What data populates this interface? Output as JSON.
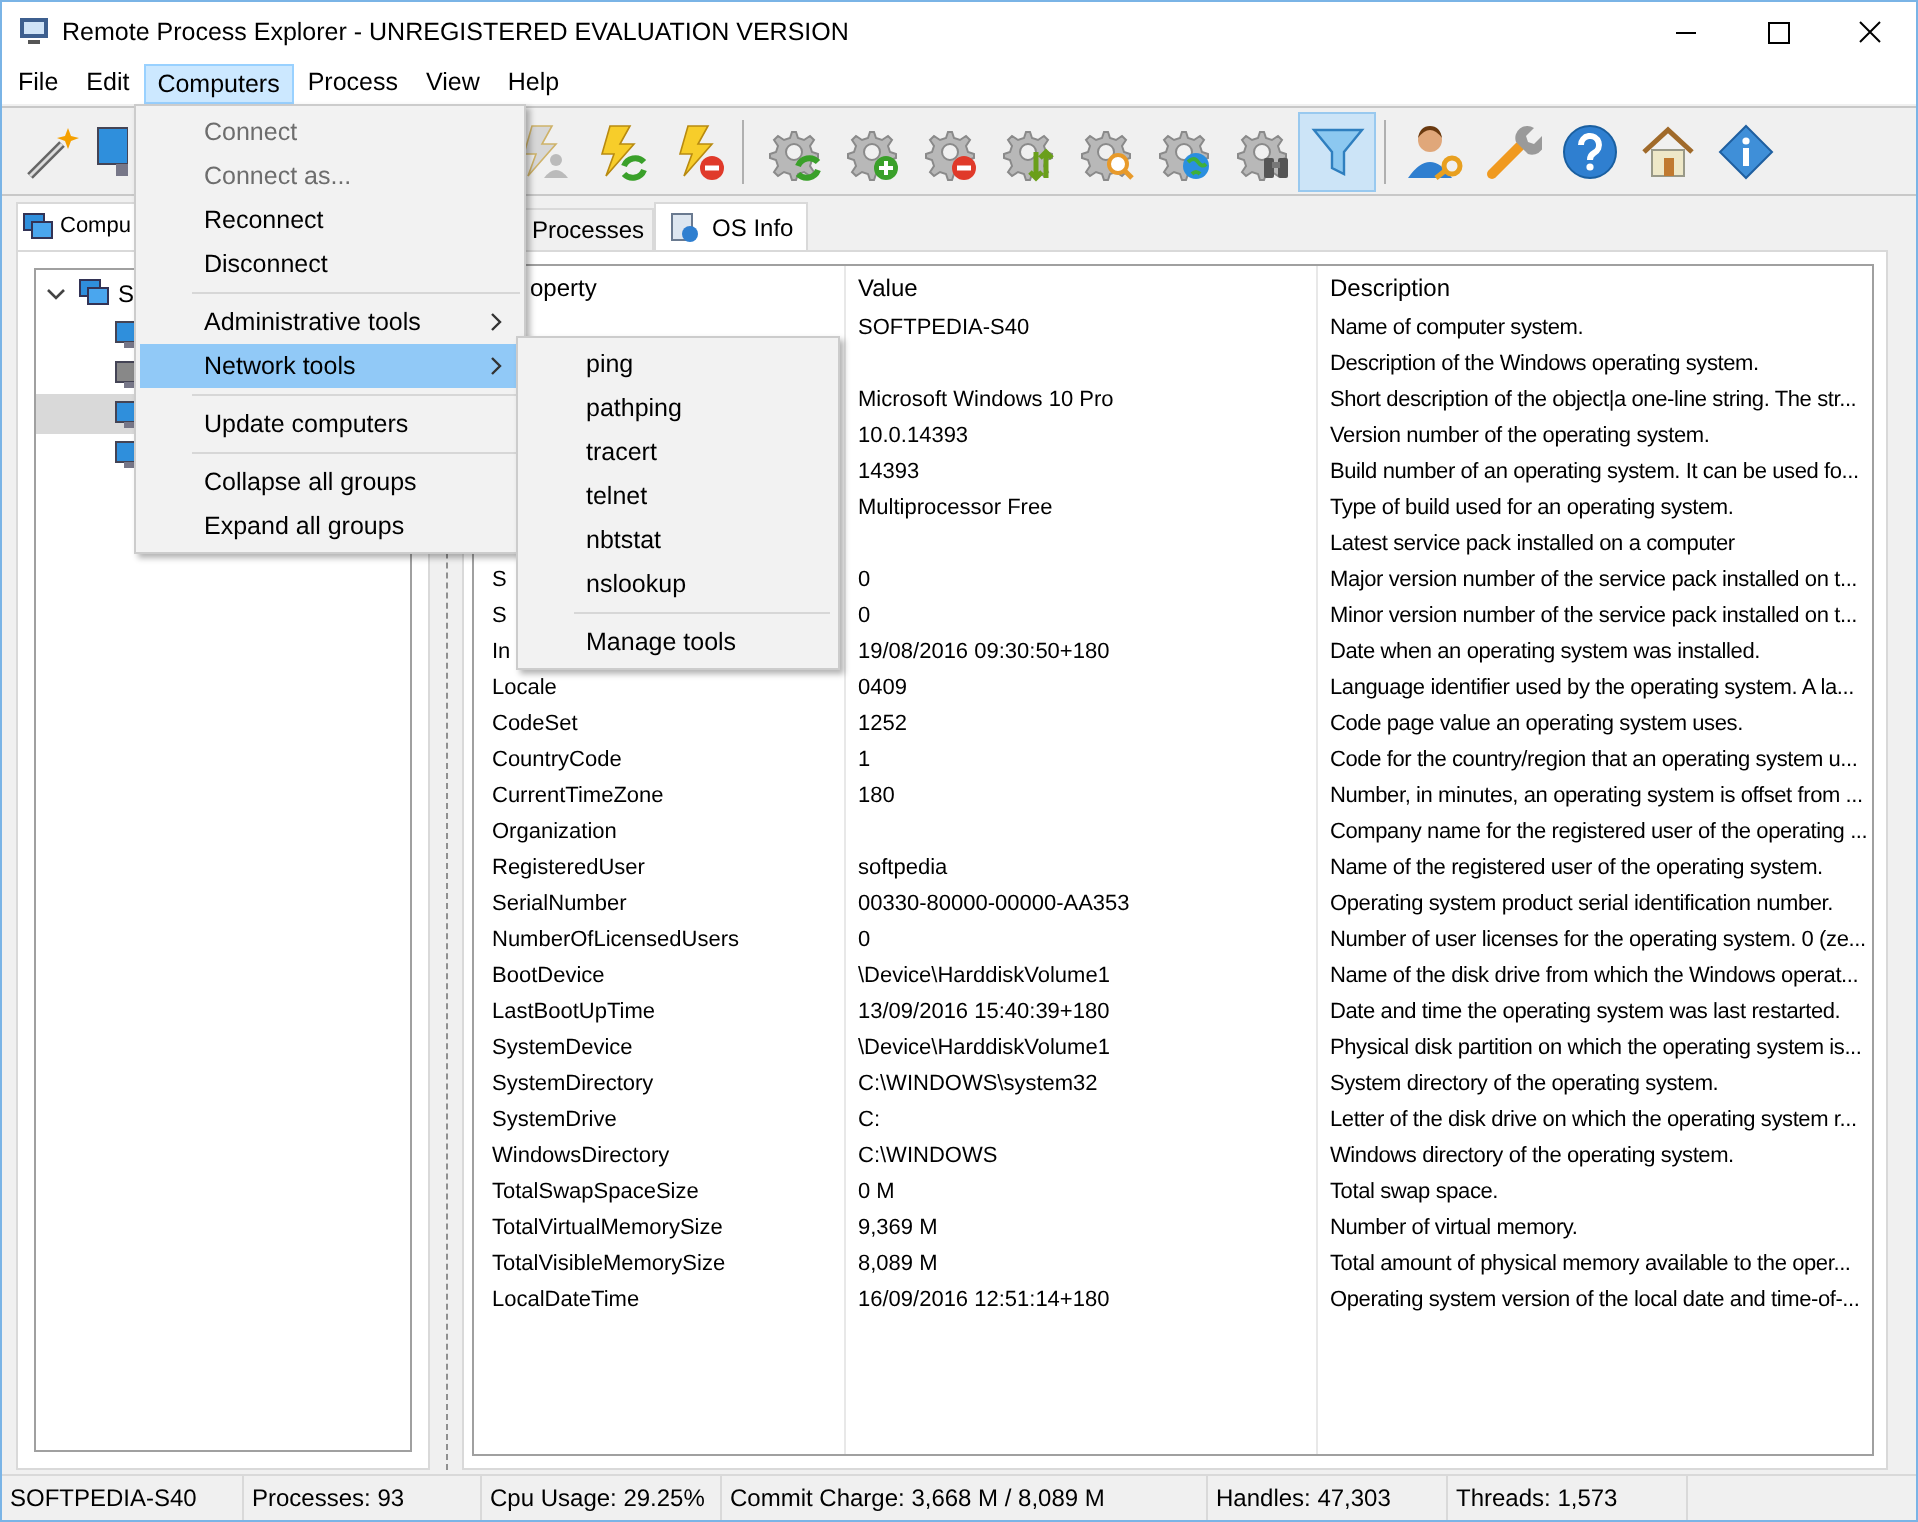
{
  "window": {
    "title": "Remote Process Explorer - UNREGISTERED EVALUATION VERSION"
  },
  "menu_bar": [
    {
      "label": "File",
      "selected": false
    },
    {
      "label": "Edit",
      "selected": false
    },
    {
      "label": "Computers",
      "selected": true
    },
    {
      "label": "Process",
      "selected": false
    },
    {
      "label": "View",
      "selected": false
    },
    {
      "label": "Help",
      "selected": false
    }
  ],
  "toolbar": [
    {
      "kind": "wand",
      "disabled": false,
      "pressed": false
    },
    {
      "kind": "monitor",
      "disabled": false,
      "pressed": false
    },
    {
      "kind": "gap"
    },
    {
      "kind": "lightning-user",
      "disabled": true,
      "pressed": false
    },
    {
      "kind": "lightning-refresh",
      "disabled": false,
      "pressed": false
    },
    {
      "kind": "lightning-minus",
      "disabled": false,
      "pressed": false
    },
    {
      "kind": "separator"
    },
    {
      "kind": "gear-refresh",
      "disabled": false,
      "pressed": false
    },
    {
      "kind": "gear-plus",
      "disabled": false,
      "pressed": false
    },
    {
      "kind": "gear-minus",
      "disabled": false,
      "pressed": false
    },
    {
      "kind": "gear-arrows",
      "disabled": false,
      "pressed": false
    },
    {
      "kind": "gear-search",
      "disabled": false,
      "pressed": false
    },
    {
      "kind": "gear-globe",
      "disabled": false,
      "pressed": false
    },
    {
      "kind": "gear-binoculars",
      "disabled": false,
      "pressed": false
    },
    {
      "kind": "funnel",
      "disabled": false,
      "pressed": true
    },
    {
      "kind": "separator"
    },
    {
      "kind": "user-key",
      "disabled": false,
      "pressed": false
    },
    {
      "kind": "wrench",
      "disabled": false,
      "pressed": false
    },
    {
      "kind": "help",
      "disabled": false,
      "pressed": false
    },
    {
      "kind": "home",
      "disabled": false,
      "pressed": false
    },
    {
      "kind": "info",
      "disabled": false,
      "pressed": false
    }
  ],
  "left_panel": {
    "tab": "Compu",
    "tree": [
      {
        "label": "S",
        "expanded": true,
        "selected": false,
        "children": [
          {
            "selected": false,
            "online": true
          },
          {
            "selected": false,
            "online": false
          },
          {
            "selected": true,
            "online": true
          },
          {
            "selected": false,
            "online": true
          }
        ]
      }
    ]
  },
  "right_tabs": [
    {
      "label": "Processes",
      "selected": false
    },
    {
      "label": "OS Info",
      "selected": true
    }
  ],
  "table": {
    "columns": [
      "operty",
      "Value",
      "Description"
    ],
    "rows": [
      [
        "",
        "SOFTPEDIA-S40",
        "Name of computer system."
      ],
      [
        "",
        "",
        "Description of the Windows operating system."
      ],
      [
        "",
        "Microsoft Windows 10 Pro",
        "Short description of the object|a one-line string. The str..."
      ],
      [
        "",
        "10.0.14393",
        "Version number of the operating system."
      ],
      [
        "",
        "14393",
        "Build number of an operating system. It can be used fo..."
      ],
      [
        "",
        "Multiprocessor Free",
        "Type of build used for an operating system."
      ],
      [
        "",
        "",
        "Latest service pack installed on a computer"
      ],
      [
        "S",
        "0",
        "Major version number of the service pack installed on t..."
      ],
      [
        "S",
        "0",
        "Minor version number of the service pack installed on t..."
      ],
      [
        "In",
        "19/08/2016 09:30:50+180",
        "Date when an operating system was installed."
      ],
      [
        "Locale",
        "0409",
        "Language identifier used by the operating system. A la..."
      ],
      [
        "CodeSet",
        "1252",
        "Code page value an operating system uses."
      ],
      [
        "CountryCode",
        "1",
        "Code for the country/region that an operating system u..."
      ],
      [
        "CurrentTimeZone",
        "180",
        "Number, in minutes, an operating system is offset from ..."
      ],
      [
        "Organization",
        "",
        "Company name for the registered user of the operating ..."
      ],
      [
        "RegisteredUser",
        "softpedia",
        "Name of the registered user of the operating system."
      ],
      [
        "SerialNumber",
        "00330-80000-00000-AA353",
        "Operating system product serial identification number."
      ],
      [
        "NumberOfLicensedUsers",
        "0",
        "Number of user licenses for the operating system. 0 (ze..."
      ],
      [
        "BootDevice",
        "\\Device\\HarddiskVolume1",
        "Name of the disk drive from which the Windows operat..."
      ],
      [
        "LastBootUpTime",
        "13/09/2016 15:40:39+180",
        "Date and time the operating system was last restarted."
      ],
      [
        "SystemDevice",
        "\\Device\\HarddiskVolume1",
        "Physical disk partition on which the operating system is..."
      ],
      [
        "SystemDirectory",
        "C:\\WINDOWS\\system32",
        "System directory of the operating system."
      ],
      [
        "SystemDrive",
        "C:",
        "Letter of the disk drive on which the operating system r..."
      ],
      [
        "WindowsDirectory",
        "C:\\WINDOWS",
        "Windows directory of the operating system."
      ],
      [
        "TotalSwapSpaceSize",
        "0 M",
        "Total swap space."
      ],
      [
        "TotalVirtualMemorySize",
        "9,369 M",
        "Number of virtual memory."
      ],
      [
        "TotalVisibleMemorySize",
        "8,089 M",
        "Total amount of physical memory available to the oper..."
      ],
      [
        "LocalDateTime",
        "16/09/2016 12:51:14+180",
        "Operating system version of the local date and time-of-..."
      ]
    ]
  },
  "computers_menu": [
    {
      "kind": "item",
      "label": "Connect",
      "disabled": true,
      "selected": false
    },
    {
      "kind": "item",
      "label": "Connect as...",
      "disabled": true,
      "selected": false
    },
    {
      "kind": "item",
      "label": "Reconnect",
      "disabled": false,
      "selected": false
    },
    {
      "kind": "item",
      "label": "Disconnect",
      "disabled": false,
      "selected": false
    },
    {
      "kind": "separator"
    },
    {
      "kind": "submenu",
      "label": "Administrative tools",
      "disabled": false,
      "selected": false
    },
    {
      "kind": "submenu",
      "label": "Network tools",
      "disabled": false,
      "selected": true
    },
    {
      "kind": "separator"
    },
    {
      "kind": "item",
      "label": "Update computers",
      "disabled": false,
      "selected": false
    },
    {
      "kind": "separator"
    },
    {
      "kind": "item",
      "label": "Collapse all groups",
      "disabled": false,
      "selected": false
    },
    {
      "kind": "item",
      "label": "Expand all groups",
      "disabled": false,
      "selected": false
    }
  ],
  "network_tools_menu": [
    {
      "kind": "item",
      "label": "ping"
    },
    {
      "kind": "item",
      "label": "pathping"
    },
    {
      "kind": "item",
      "label": "tracert"
    },
    {
      "kind": "item",
      "label": "telnet"
    },
    {
      "kind": "item",
      "label": "nbtstat"
    },
    {
      "kind": "item",
      "label": "nslookup"
    },
    {
      "kind": "separator"
    },
    {
      "kind": "item",
      "label": "Manage tools"
    }
  ],
  "status_bar": [
    "SOFTPEDIA-S40",
    "Processes: 93",
    "Cpu Usage: 29.25%",
    "Commit Charge: 3,668 M / 8,089 M",
    "Handles: 47,303",
    "Threads: 1,573"
  ]
}
